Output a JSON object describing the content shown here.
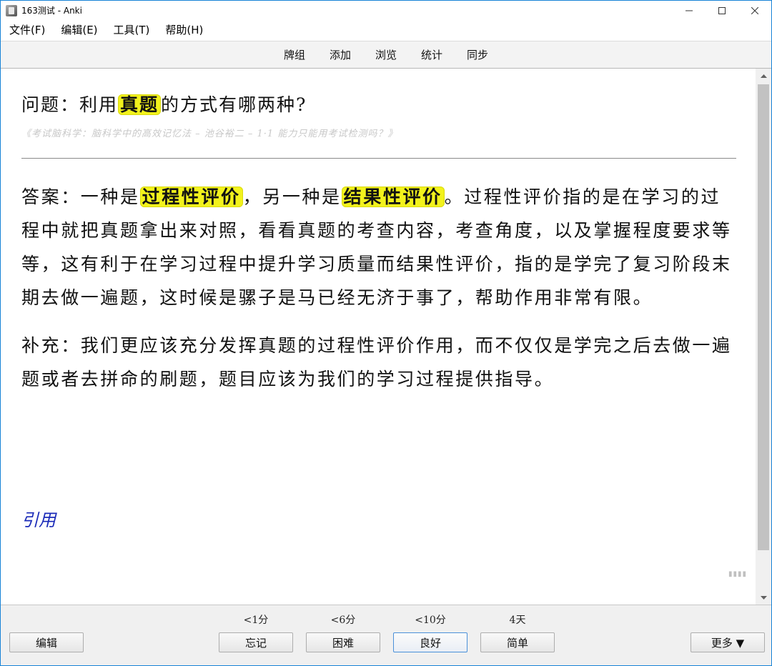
{
  "window": {
    "title": "163测试 - Anki",
    "minimize_glyph": "—",
    "maximize_glyph": "☐",
    "close_glyph": "✕"
  },
  "menu": {
    "items": [
      "文件(F)",
      "编辑(E)",
      "工具(T)",
      "帮助(H)"
    ]
  },
  "toolbar": {
    "links": [
      "牌组",
      "添加",
      "浏览",
      "统计",
      "同步"
    ]
  },
  "card": {
    "question_prefix": "问题：利用",
    "question_highlight": "真题",
    "question_suffix": "的方式有哪两种?",
    "source": "《考试脑科学：脑科学中的高效记忆法 – 池谷裕二 – 1·1 能力只能用考试检测吗？》",
    "answer_prefix": "答案：一种是",
    "answer_highlight_1": "过程性评价",
    "answer_middle": "，另一种是",
    "answer_highlight_2": "结果性评价",
    "answer_rest": "。过程性评价指的是在学习的过程中就把真题拿出来对照，看看真题的考查内容，考查角度，以及掌握程度要求等等，这有利于在学习过程中提升学习质量而结果性评价，指的是学完了复习阶段末期去做一遍题，这时候是骡子是马已经无济于事了，帮助作用非常有限。",
    "supplement": "补充：我们更应该充分发挥真题的过程性评价作用，而不仅仅是学完之后去做一遍题或者去拼命的刷题，题目应该为我们的学习过程提供指导。",
    "quote_label": "引用",
    "resize_glyph": "▮▮▮▮"
  },
  "bottom": {
    "edit_label": "编辑",
    "more_label": "更多 ▼",
    "answers": [
      {
        "label": "忘记",
        "interval": "<1分"
      },
      {
        "label": "困难",
        "interval": "<6分"
      },
      {
        "label": "良好",
        "interval": "<10分"
      },
      {
        "label": "简单",
        "interval": "4天"
      }
    ]
  },
  "colors": {
    "highlight": "#f2f21c",
    "quote": "#1a2ab8",
    "window_border": "#1883d7"
  }
}
